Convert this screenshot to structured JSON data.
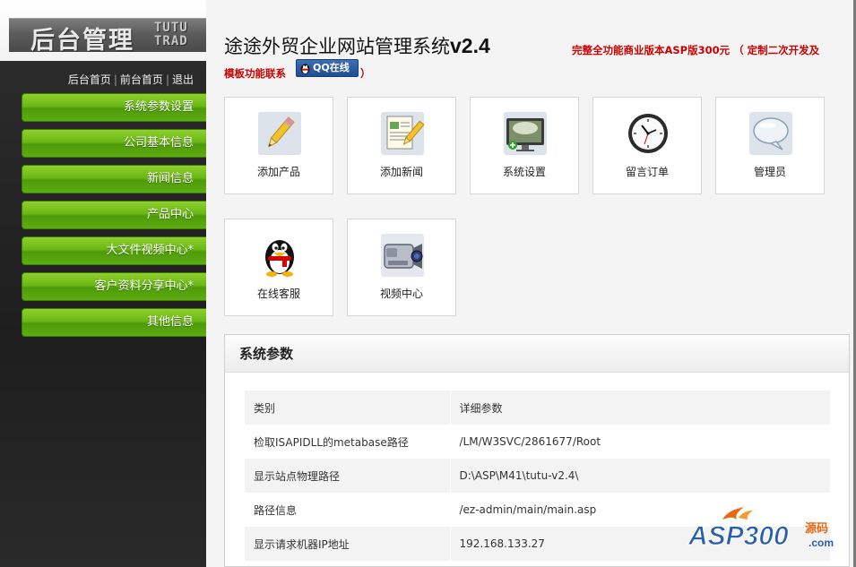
{
  "sidebar": {
    "logo_cn": "后台管理",
    "logo_en_1": "TUTU",
    "logo_en_2": "TRAD",
    "top_links": [
      "后台首页",
      "前台首页",
      "退出"
    ],
    "menu": [
      "系统参数设置",
      "公司基本信息",
      "新闻信息",
      "产品中心",
      "大文件视频中心*",
      "客户资料分享中心*",
      "其他信息"
    ]
  },
  "header": {
    "title": "途途外贸企业网站管理系统",
    "version": "v2.4",
    "promo_line1": "完整全功能商业版本ASP版300元 （ 定制二次开发及",
    "promo_line2": "模板功能联系",
    "qq_label": "QQ在线",
    "promo_close": "）"
  },
  "shortcuts": [
    {
      "label": "添加产品",
      "icon": "pencil-icon"
    },
    {
      "label": "添加新闻",
      "icon": "document-edit-icon"
    },
    {
      "label": "系统设置",
      "icon": "monitor-icon"
    },
    {
      "label": "留言订单",
      "icon": "clock-icon"
    },
    {
      "label": "管理员",
      "icon": "speech-bubble-icon"
    },
    {
      "label": "在线客服",
      "icon": "qq-penguin-icon"
    },
    {
      "label": "视频中心",
      "icon": "video-camera-icon"
    }
  ],
  "panel": {
    "title": "系统参数",
    "rows": [
      {
        "k": "类别",
        "v": "详细参数"
      },
      {
        "k": "检取ISAPIDLL的metabase路径",
        "v": "/LM/W3SVC/2861677/Root"
      },
      {
        "k": "显示站点物理路径",
        "v": "D:\\ASP\\M41\\tutu-v2.4\\"
      },
      {
        "k": "路径信息",
        "v": "/ez-admin/main/main.asp"
      },
      {
        "k": "显示请求机器IP地址",
        "v": "192.168.133.27"
      }
    ]
  },
  "watermark": {
    "brand": "ASP300",
    "suffix": "源码",
    "domain": ".com"
  }
}
